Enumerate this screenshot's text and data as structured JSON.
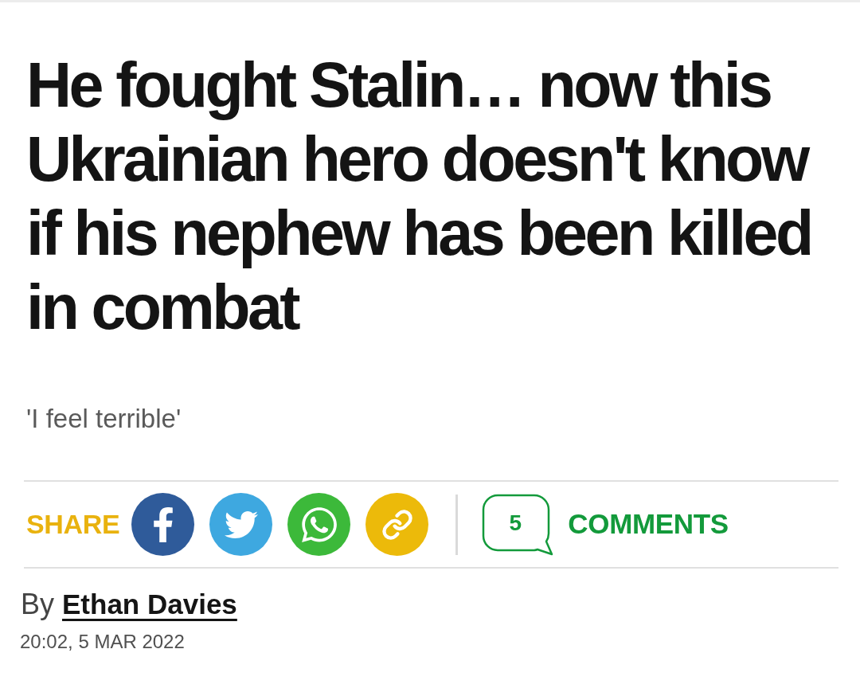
{
  "headline": "He fought Stalin… now this Ukrainian hero doesn't know if his nephew has been killed in combat",
  "standfirst": "'I feel terrible'",
  "share": {
    "label": "SHARE",
    "buttons": [
      {
        "kind": "facebook",
        "color": "#2f5b9a"
      },
      {
        "kind": "twitter",
        "color": "#3ea8e0"
      },
      {
        "kind": "whatsapp",
        "color": "#3cb93a"
      },
      {
        "kind": "link",
        "color": "#ecba0a"
      }
    ]
  },
  "comments": {
    "count": "5",
    "label": "COMMENTS"
  },
  "byline": {
    "prefix": "By",
    "author": "Ethan Davies"
  },
  "timestamp": "20:02, 5 MAR 2022"
}
